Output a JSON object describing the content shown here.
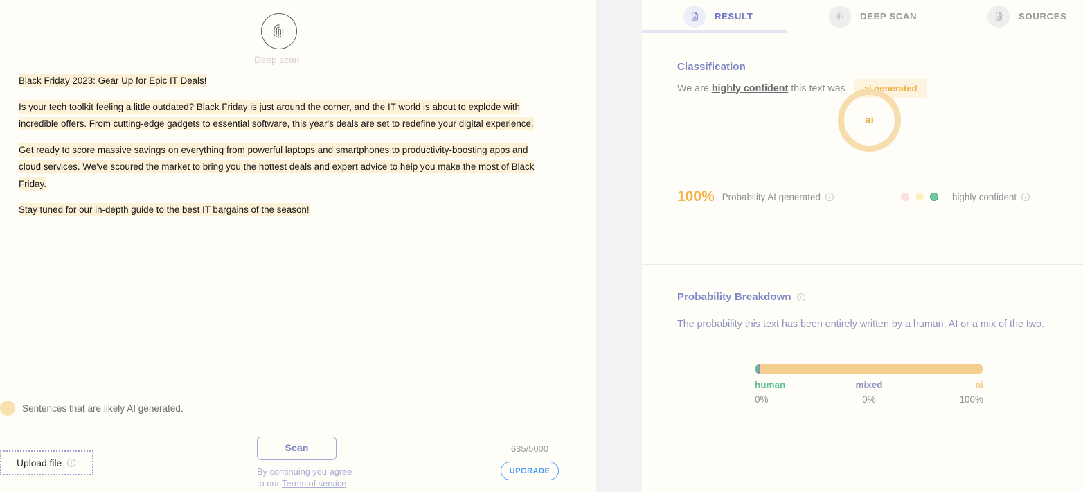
{
  "left": {
    "deep_scan": {
      "label": "Deep scan",
      "icon": "fingerprint-icon"
    },
    "document": {
      "paragraphs": [
        "Black Friday 2023: Gear Up for Epic IT Deals!",
        "Is your tech toolkit feeling a little outdated? Black Friday is just around the corner, and the IT world is about to explode with incredible offers. From cutting-edge gadgets to essential software, this year's deals are set to redefine your digital experience.",
        "Get ready to score massive savings on everything from powerful laptops and smartphones to productivity-boosting apps and cloud services. We've scoured the market to bring you the hottest deals and expert advice to help you make the most of Black Friday.",
        "Stay tuned for our in-depth guide to the best IT bargains of the season!"
      ]
    },
    "legend": {
      "label": "Sentences that are likely AI generated.",
      "dot_color": "#f8e2b0"
    },
    "upload": {
      "label": "Upload file",
      "info_icon": "info-icon"
    },
    "scan": {
      "button_label": "Scan",
      "terms_prefix": "By continuing you agree",
      "terms_middle": "to our ",
      "terms_link": "Terms of service"
    },
    "quota": {
      "count": "635/5000",
      "upgrade_label": "UPGRADE",
      "upgrade_color": "#4d9bfb"
    }
  },
  "right": {
    "tabs": [
      {
        "label": "RESULT",
        "icon": "document-chart-icon",
        "active": true
      },
      {
        "label": "DEEP SCAN",
        "icon": "fingerprint-icon",
        "active": false
      },
      {
        "label": "SOURCES",
        "icon": "document-search-icon",
        "active": false
      }
    ],
    "classification": {
      "heading": "Classification",
      "sentence_prefix": "We are",
      "confidence_phrase": "highly confident",
      "sentence_suffix": "this text was",
      "badge": "ai generated",
      "badge_color": "#efae45",
      "ring_label": "ai",
      "ring_color": "#f7ddae",
      "probability_value": "100%",
      "probability_label": "Probability AI generated",
      "confidence_label": "highly confident",
      "confidence_dots": [
        {
          "name": "low",
          "color": "#fbdfe1",
          "active": false
        },
        {
          "name": "medium",
          "color": "#f9f3c4",
          "active": false
        },
        {
          "name": "high",
          "color": "#6fc89a",
          "active": true
        }
      ]
    },
    "breakdown": {
      "heading": "Probability Breakdown",
      "description": "The probability this text has been entirely written by a human, AI or a mix of the two."
    }
  },
  "chart_data": {
    "type": "bar",
    "title": "Probability Breakdown",
    "subtitle": "The probability this text has been entirely written by a human, AI or a mix of the two.",
    "orientation": "horizontal-stacked",
    "categories": [
      "human",
      "mixed",
      "ai"
    ],
    "values": [
      0,
      0,
      100
    ],
    "value_labels": [
      "0%",
      "0%",
      "100%"
    ],
    "colors": [
      "#5ec291",
      "#8d93c0",
      "#f4ce8f"
    ],
    "ylim": [
      0,
      100
    ],
    "legend": "inline-below",
    "grid": false
  }
}
